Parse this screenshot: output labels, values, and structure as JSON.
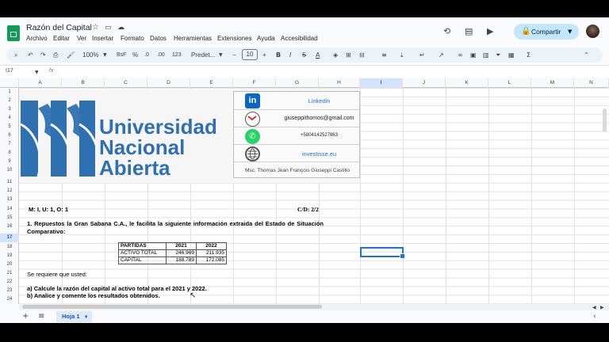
{
  "doc": {
    "title": "Razón del Capital"
  },
  "menu": [
    "Archivo",
    "Editar",
    "Ver",
    "Insertar",
    "Formato",
    "Datos",
    "Herramientas",
    "Extensiones",
    "Ayuda",
    "Accesibilidad"
  ],
  "share_label": "Compartir",
  "toolbar": {
    "zoom": "100%",
    "currency": "BsF",
    "percent": "%",
    "dec_less": ".0",
    "dec_more": ".00",
    "format123": "123",
    "font": "Predet...",
    "minus": "−",
    "font_size": "10",
    "plus": "+"
  },
  "formula": {
    "cell_ref": "I17",
    "fx": "fx"
  },
  "columns": [
    "A",
    "B",
    "C",
    "D",
    "E",
    "F",
    "G",
    "H",
    "I",
    "J",
    "K",
    "L",
    "M",
    "N"
  ],
  "rows": [
    "1",
    "2",
    "3",
    "4",
    "5",
    "6",
    "7",
    "8",
    "9",
    "10",
    "11",
    "12",
    "13",
    "14",
    "15",
    "16",
    "17",
    "18",
    "19",
    "20",
    "21",
    "22",
    "23",
    "24"
  ],
  "banner": {
    "line1": "Universidad",
    "line2": "Nacional",
    "line3": "Abierta"
  },
  "contacts": {
    "linkedin": "Linkedin",
    "email": "giuseppithomos@gmail.com",
    "phone": "+5804142527863",
    "web": "investisse.eu",
    "author": "Msc. Thomas Jean François Giuseppi Castillo",
    "li_glyph": "in"
  },
  "content": {
    "meta_left": "M: I, U: 1, O: 1",
    "meta_right": "C/D: 2/2",
    "statement": "1.  Repuestos la Gran Sabana C.A., le facilita la siguiente información extraida del Estado de Situación Comparativo:",
    "table": {
      "headers": [
        "PARTIDAS",
        "2021",
        "2022"
      ],
      "rows": [
        [
          "ACTIVO TOTAL",
          "246.969",
          "211.935"
        ],
        [
          "CAPITAL",
          "188.789",
          "172.085"
        ]
      ]
    },
    "request": "Se requiere que usted:",
    "task_a": "a) Calcule la razón del capital al activo total para el 2021 y 2022.",
    "task_b": "b) Analice y comente los resultados obtenidos."
  },
  "sheet": {
    "tab": "Hoja 1"
  },
  "colors": {
    "accent": "#0b57d0",
    "share_bg": "#c2e7ff",
    "brand_blue": "#2f70b0",
    "sheets_green": "#0f9d58"
  }
}
